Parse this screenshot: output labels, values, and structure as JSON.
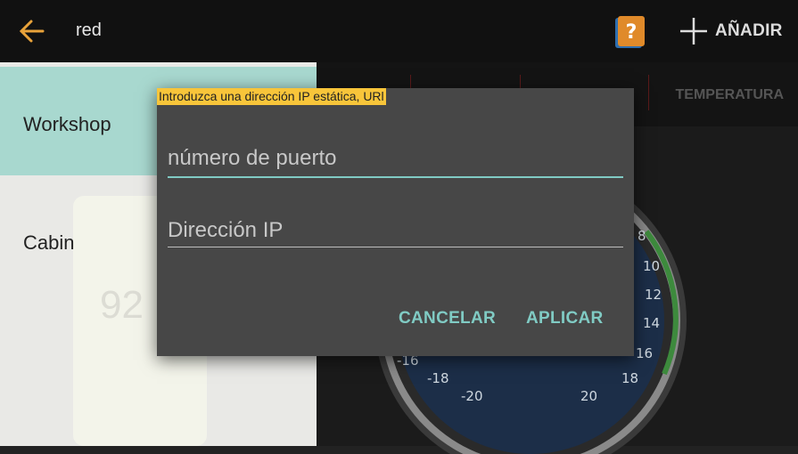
{
  "appbar": {
    "title": "red",
    "add_label": "AÑADIR",
    "colors": {
      "background": "#111111",
      "back_arrow": "#e8a23a"
    }
  },
  "sidebar": {
    "items": [
      {
        "label": "Workshop",
        "selected": true
      },
      {
        "label": "Cabin",
        "selected": false
      }
    ],
    "gauge_value": "92"
  },
  "tabs": {
    "visible_label": "TEMPERATURA"
  },
  "gauge": {
    "ticks_right": [
      "8",
      "10",
      "12",
      "14",
      "16",
      "18",
      "20"
    ],
    "ticks_left": [
      "-20",
      "-18",
      "-16"
    ]
  },
  "dialog": {
    "hint": "Introduzca una dirección IP estática, URl",
    "port_placeholder": "número de puerto",
    "ip_placeholder": "Dirección IP",
    "cancel_label": "CANCELAR",
    "apply_label": "APLICAR",
    "colors": {
      "accent": "#80cbc4",
      "hint_bg": "#f8c53a",
      "surface": "#474747"
    }
  },
  "icons": {
    "back": "arrow-left-icon",
    "help": "help-book-icon",
    "add": "plus-icon"
  }
}
